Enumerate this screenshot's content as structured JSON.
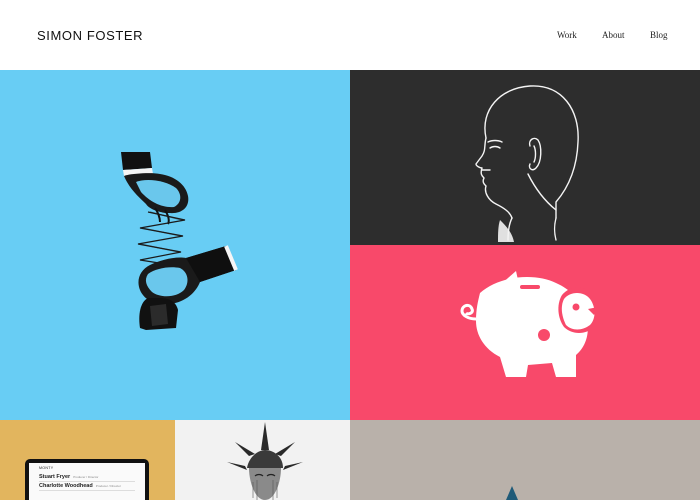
{
  "header": {
    "logo": "SIMON FOSTER",
    "nav": [
      {
        "label": "Work"
      },
      {
        "label": "About"
      },
      {
        "label": "Blog"
      }
    ]
  },
  "tiles": [
    {
      "subject": "hands-spring-illustration",
      "background": "#68cdf4"
    },
    {
      "subject": "head-profile-line-drawing",
      "background": "#2d2d2d"
    },
    {
      "subject": "piggy-bank-bird-logo",
      "background": "#f8496a"
    },
    {
      "subject": "laptop-website-mockup",
      "background": "#e2b55e"
    },
    {
      "subject": "statue-of-liberty-engraving",
      "background": "#f2f2f2"
    },
    {
      "subject": "partial-illustration",
      "background": "#b9b1aa"
    }
  ],
  "laptop_screen": {
    "title": "MONTY",
    "rows": [
      {
        "name": "Stuart Fryer",
        "role": "Producer / Director"
      },
      {
        "name": "Charlotte Woodhead",
        "role": "Producer / Director"
      }
    ]
  },
  "colors": {
    "blue": "#68cdf4",
    "dark": "#2d2d2d",
    "pink": "#f8496a",
    "gold": "#e2b55e",
    "light": "#f2f2f2",
    "taupe": "#b9b1aa"
  }
}
